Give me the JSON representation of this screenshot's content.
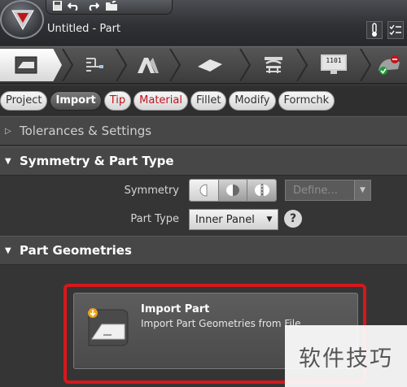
{
  "window": {
    "title": "Untitled - Part"
  },
  "quick_access": {
    "icons": [
      "save-icon",
      "undo-icon",
      "redo-icon",
      "open-icon"
    ]
  },
  "ribbon": {
    "tabs": [
      {
        "icon": "part-sheet-icon",
        "active": true
      },
      {
        "icon": "fixture-icon",
        "active": false
      },
      {
        "icon": "stamping-die-icon",
        "active": false
      },
      {
        "icon": "blank-sheet-icon",
        "active": false
      },
      {
        "icon": "press-icon",
        "active": false
      },
      {
        "icon": "monitor-binary-icon",
        "label": "1101",
        "active": false
      },
      {
        "icon": "results-icon",
        "active": false
      }
    ]
  },
  "steps": {
    "pills": [
      {
        "label": "Project",
        "state": "normal"
      },
      {
        "label": "Import",
        "state": "active"
      },
      {
        "label": "Tip",
        "state": "required"
      },
      {
        "label": "Material",
        "state": "required"
      },
      {
        "label": "Fillet",
        "state": "normal"
      },
      {
        "label": "Modify",
        "state": "normal"
      },
      {
        "label": "Formchk",
        "state": "normal"
      }
    ],
    "colors": {
      "required": "#c0141b",
      "active_bg": "#5a5a5a"
    }
  },
  "panel": {
    "tolerances": {
      "title": "Tolerances & Settings",
      "expanded": false
    },
    "symmetry": {
      "title": "Symmetry & Part Type",
      "expanded": true,
      "symmetry_label": "Symmetry",
      "symmetry_options": [
        "none-symmetry-icon",
        "half-symmetry-icon",
        "mirror-symmetry-icon"
      ],
      "define_placeholder": "Define...",
      "part_type_label": "Part Type",
      "part_type_value": "Inner Panel"
    },
    "geometries": {
      "title": "Part Geometries",
      "expanded": true,
      "import_card": {
        "title": "Import Part",
        "description": "Import Part Geometries from File"
      }
    }
  },
  "watermark": {
    "text": "软件技巧"
  },
  "highlight_color": "#d5181c"
}
